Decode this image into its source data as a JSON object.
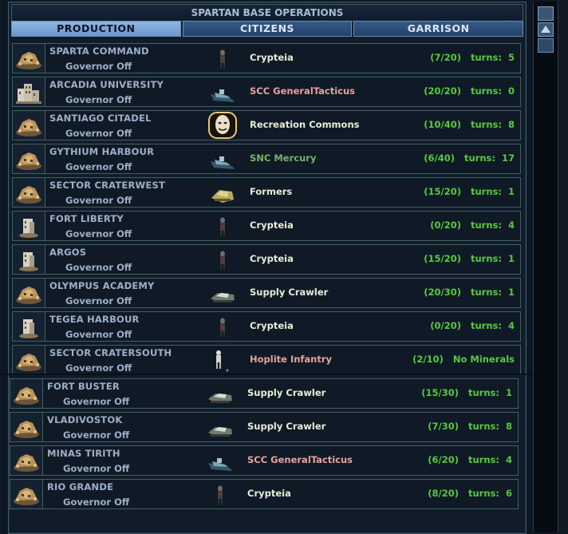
{
  "window": {
    "title": "SPARTAN BASE OPERATIONS"
  },
  "tabs": [
    {
      "label": "PRODUCTION",
      "active": true
    },
    {
      "label": "CITIZENS",
      "active": false
    },
    {
      "label": "GARRISON",
      "active": false
    }
  ],
  "bases": [
    {
      "name": "SPARTA COMMAND",
      "governor": "Governor Off",
      "base_icon": "base-dome-icon",
      "unit_icon": "probe-unit-icon",
      "production": "Crypteia",
      "production_color": "white",
      "progress": "(7/20)",
      "turns": "turns:  5"
    },
    {
      "name": "ARCADIA UNIVERSITY",
      "governor": "Governor Off",
      "base_icon": "base-city-icon",
      "unit_icon": "sea-unit-icon",
      "production": "SCC GeneralTacticus",
      "production_color": "pink",
      "progress": "(20/20)",
      "turns": "turns:  0"
    },
    {
      "name": "SANTIAGO CITADEL",
      "governor": "Governor Off",
      "base_icon": "base-dome-icon",
      "unit_icon": "facility-face-icon",
      "production": "Recreation Commons",
      "production_color": "white",
      "progress": "(10/40)",
      "turns": "turns:  8"
    },
    {
      "name": "GYTHIUM HARBOUR",
      "governor": "Governor Off",
      "base_icon": "base-dome-icon",
      "unit_icon": "sea-unit-icon",
      "production": "SNC Mercury",
      "production_color": "green",
      "progress": "(6/40)",
      "turns": "turns:  17"
    },
    {
      "name": "SECTOR CRATERWEST",
      "governor": "Governor Off",
      "base_icon": "base-dome-icon",
      "unit_icon": "former-unit-icon",
      "production": "Formers",
      "production_color": "white",
      "progress": "(15/20)",
      "turns": "turns:  1"
    },
    {
      "name": "FORT LIBERTY",
      "governor": "Governor Off",
      "base_icon": "base-tower-icon",
      "unit_icon": "probe-unit-icon",
      "production": "Crypteia",
      "production_color": "white",
      "progress": "(0/20)",
      "turns": "turns:  4"
    },
    {
      "name": "ARGOS",
      "governor": "Governor Off",
      "base_icon": "base-tower-icon",
      "unit_icon": "probe-unit-icon",
      "production": "Crypteia",
      "production_color": "white",
      "progress": "(15/20)",
      "turns": "turns:  1"
    },
    {
      "name": "OLYMPUS ACADEMY",
      "governor": "Governor Off",
      "base_icon": "base-dome-icon",
      "unit_icon": "crawler-unit-icon",
      "production": "Supply Crawler",
      "production_color": "white",
      "progress": "(20/30)",
      "turns": "turns:  1"
    },
    {
      "name": "TEGEA HARBOUR",
      "governor": "Governor Off",
      "base_icon": "base-tower-icon",
      "unit_icon": "probe-unit-icon",
      "production": "Crypteia",
      "production_color": "white",
      "progress": "(0/20)",
      "turns": "turns:  4"
    },
    {
      "name": "SECTOR CRATERSOUTH",
      "governor": "Governor Off",
      "base_icon": "base-dome-icon",
      "unit_icon": "infantry-unit-icon",
      "production": "Hoplite Infantry",
      "production_color": "pink",
      "progress": "(2/10)",
      "turns": "No Minerals"
    },
    {
      "name": "FORT BUSTER",
      "governor": "Governor Off",
      "base_icon": "base-dome-icon",
      "unit_icon": "crawler-unit-icon",
      "production": "Supply Crawler",
      "production_color": "white",
      "progress": "(15/30)",
      "turns": "turns:  1"
    },
    {
      "name": "VLADIVOSTOK",
      "governor": "Governor Off",
      "base_icon": "base-dome-icon",
      "unit_icon": "crawler-unit-icon",
      "production": "Supply Crawler",
      "production_color": "white",
      "progress": "(7/30)",
      "turns": "turns:  8"
    },
    {
      "name": "MINAS TIRITH",
      "governor": "Governor Off",
      "base_icon": "base-dome-icon",
      "unit_icon": "sea-unit-icon",
      "production": "SCC GeneralTacticus",
      "production_color": "pink",
      "progress": "(6/20)",
      "turns": "turns:  4"
    },
    {
      "name": "RIO GRANDE",
      "governor": "Governor Off",
      "base_icon": "base-dome-icon",
      "unit_icon": "probe-unit-icon",
      "production": "Crypteia",
      "production_color": "white",
      "progress": "(8/20)",
      "turns": "turns:  6"
    }
  ],
  "scrollbar": {
    "up_icon": "scroll-up-arrow-icon"
  }
}
